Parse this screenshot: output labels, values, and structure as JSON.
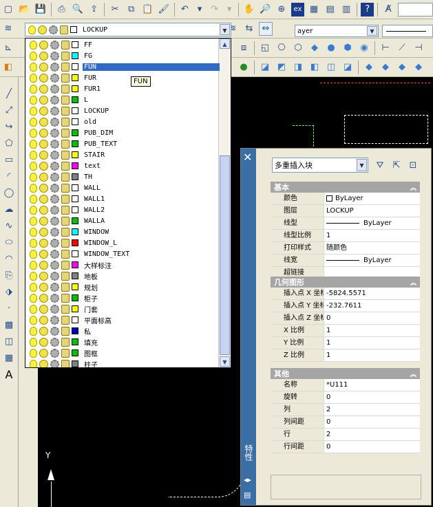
{
  "layer_dropdown": {
    "current": "LOCKUP",
    "items": [
      {
        "name": "FF",
        "color": "#ffffff"
      },
      {
        "name": "FG",
        "color": "#00ffff"
      },
      {
        "name": "FUN",
        "color": "#ffffff",
        "selected": true
      },
      {
        "name": "FUR",
        "color": "#ffff00"
      },
      {
        "name": "FUR1",
        "color": "#ffff00"
      },
      {
        "name": "L",
        "color": "#00c000"
      },
      {
        "name": "LOCKUP",
        "color": "#ffffff"
      },
      {
        "name": "old",
        "color": "#ffffff"
      },
      {
        "name": "PUB_DIM",
        "color": "#00c000"
      },
      {
        "name": "PUB_TEXT",
        "color": "#00c000"
      },
      {
        "name": "STAIR",
        "color": "#ffff00"
      },
      {
        "name": "text",
        "color": "#ff00ff"
      },
      {
        "name": "TH",
        "color": "#808080"
      },
      {
        "name": "WALL",
        "color": "#ffffff"
      },
      {
        "name": "WALL1",
        "color": "#ffffff"
      },
      {
        "name": "WALL2",
        "color": "#ffffff"
      },
      {
        "name": "WALLA",
        "color": "#00c000"
      },
      {
        "name": "WINDOW",
        "color": "#00ffff"
      },
      {
        "name": "WINDOW_L",
        "color": "#ff0000"
      },
      {
        "name": "WINDOW_TEXT",
        "color": "#ffffff"
      },
      {
        "name": "大样标注",
        "color": "#ff00ff"
      },
      {
        "name": "地板",
        "color": "#808080"
      },
      {
        "name": "规划",
        "color": "#ffff00"
      },
      {
        "name": "柜子",
        "color": "#00c000"
      },
      {
        "name": "门套",
        "color": "#ffff00"
      },
      {
        "name": "平面标高",
        "color": "#ffffff"
      },
      {
        "name": "私",
        "color": "#0000c0"
      },
      {
        "name": "填充",
        "color": "#00c000"
      },
      {
        "name": "图框",
        "color": "#00c000"
      },
      {
        "name": "柱子",
        "color": "#808080"
      }
    ]
  },
  "tooltip": "FUN",
  "linetype_combo": "ayer",
  "properties": {
    "object_type": "多重插入块",
    "tab_label": "特性",
    "sections": [
      {
        "title": "基本",
        "rows": [
          {
            "key": "颜色",
            "value": "ByLayer",
            "kind": "color"
          },
          {
            "key": "图层",
            "value": "LOCKUP"
          },
          {
            "key": "线型",
            "value": "ByLayer",
            "kind": "line"
          },
          {
            "key": "线型比例",
            "value": "1"
          },
          {
            "key": "打印样式",
            "value": "随颜色"
          },
          {
            "key": "线宽",
            "value": "ByLayer",
            "kind": "line"
          },
          {
            "key": "超链接",
            "value": ""
          }
        ]
      },
      {
        "title": "几何图形",
        "rows": [
          {
            "key": "插入点 X 坐标",
            "value": "-5824.5571"
          },
          {
            "key": "插入点 Y 坐标",
            "value": "-232.7611"
          },
          {
            "key": "插入点 Z 坐标",
            "value": "0"
          },
          {
            "key": "X 比例",
            "value": "1"
          },
          {
            "key": "Y 比例",
            "value": "1"
          },
          {
            "key": "Z 比例",
            "value": "1"
          }
        ]
      },
      {
        "title": "其他",
        "rows": [
          {
            "key": "名称",
            "value": "*U111"
          },
          {
            "key": "旋转",
            "value": "0"
          },
          {
            "key": "列",
            "value": "2"
          },
          {
            "key": "列间距",
            "value": "0"
          },
          {
            "key": "行",
            "value": "2"
          },
          {
            "key": "行间距",
            "value": "0"
          }
        ]
      }
    ]
  },
  "ucs_label": "Y"
}
